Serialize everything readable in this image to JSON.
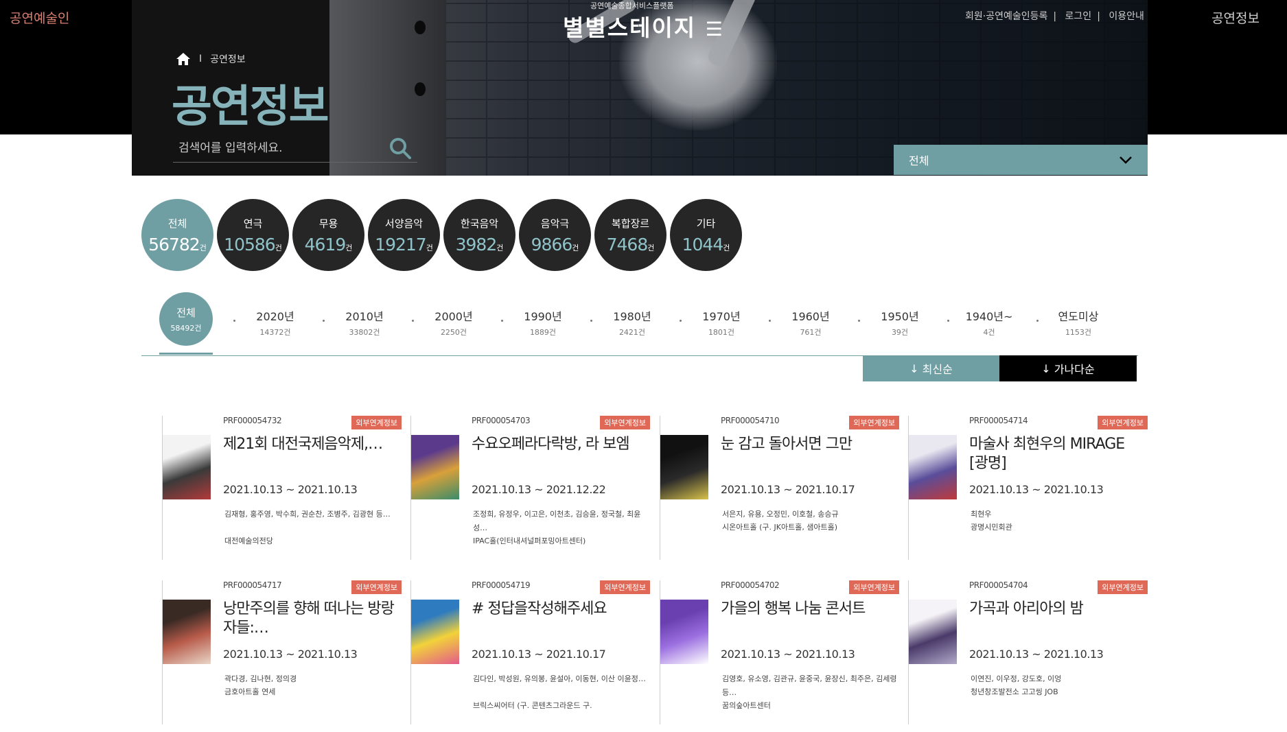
{
  "corner": {
    "left": "공연예술인",
    "right": "공연정보"
  },
  "logo": {
    "sub": "공연예술종합서비스플랫폼",
    "main": "별별스테이지"
  },
  "top_menu": [
    "회원·공연예술인등록",
    "로그인",
    "이용안내"
  ],
  "breadcrumb": {
    "separator": "I",
    "current": "공연정보"
  },
  "page_title": "공연정보",
  "search": {
    "placeholder": "검색어를 입력하세요."
  },
  "filter": {
    "selected": "전체"
  },
  "genres": [
    {
      "name": "전체",
      "count": "56782",
      "unit": "건",
      "active": true
    },
    {
      "name": "연극",
      "count": "10586",
      "unit": "건"
    },
    {
      "name": "무용",
      "count": "4619",
      "unit": "건"
    },
    {
      "name": "서양음악",
      "count": "19217",
      "unit": "건"
    },
    {
      "name": "한국음악",
      "count": "3982",
      "unit": "건"
    },
    {
      "name": "음악극",
      "count": "9866",
      "unit": "건"
    },
    {
      "name": "복합장르",
      "count": "7468",
      "unit": "건"
    },
    {
      "name": "기타",
      "count": "1044",
      "unit": "건"
    }
  ],
  "years": [
    {
      "label": "전체",
      "count": "58492건",
      "active": true
    },
    {
      "label": "2020년",
      "count": "14372건"
    },
    {
      "label": "2010년",
      "count": "33802건"
    },
    {
      "label": "2000년",
      "count": "2250건"
    },
    {
      "label": "1990년",
      "count": "1889건"
    },
    {
      "label": "1980년",
      "count": "2421건"
    },
    {
      "label": "1970년",
      "count": "1801건"
    },
    {
      "label": "1960년",
      "count": "761건"
    },
    {
      "label": "1950년",
      "count": "39건"
    },
    {
      "label": "1940년~",
      "count": "4건"
    },
    {
      "label": "연도미상",
      "count": "1153건"
    }
  ],
  "sort": {
    "latest": "최신순",
    "alpha": "가나다순"
  },
  "badge_label": "외부연계정보",
  "cards": [
    {
      "code": "PRF000054732",
      "name": "제21회 대전국제음악제,…",
      "period": "2021.10.13 ~ 2021.10.13",
      "cast": "김재형, 홍주영, 박수희, 권순찬, 조병주, 김광현 등…",
      "venue": "대전예술의전당",
      "thumb_colors": [
        "#f3f3f3",
        "#3a3a3a",
        "#b33a3a"
      ]
    },
    {
      "code": "PRF000054703",
      "name": "수요오페라다락방, 라 보엠",
      "period": "2021.10.13 ~ 2021.12.22",
      "cast": "조정희, 유정우, 이고은, 이천초, 김승윤, 정국철, 최윤성…",
      "venue": "IPAC홀(인터내셔널퍼포밍아트센터)",
      "thumb_colors": [
        "#5b3a8c",
        "#d9a03a",
        "#3a8c6a"
      ]
    },
    {
      "code": "PRF000054710",
      "name": "눈 감고 돌아서면 그만",
      "period": "2021.10.13 ~ 2021.10.17",
      "cast": "서은지, 유용, 오정민, 이호철, 송승규",
      "venue": "시온아트홀 (구. JK아트홀, 샘아트홀)",
      "thumb_colors": [
        "#111111",
        "#2a2a2a",
        "#d8c24a"
      ]
    },
    {
      "code": "PRF000054714",
      "name": "마술사 최현우의 MIRAGE [광명]",
      "period": "2021.10.13 ~ 2021.10.13",
      "cast": "최현우",
      "venue": "광명시민회관",
      "thumb_colors": [
        "#e9e7f0",
        "#5a4d9a",
        "#c03a3a"
      ]
    },
    {
      "code": "PRF000054717",
      "name": "낭만주의를 향해 떠나는 방랑자들:…",
      "period": "2021.10.13 ~ 2021.10.13",
      "cast": "곽다경, 김나현, 정의경",
      "venue": "금호아트홀 연세",
      "thumb_colors": [
        "#3a2a24",
        "#b85b4a",
        "#e8d6c8"
      ]
    },
    {
      "code": "PRF000054719",
      "name": "# 정답을작성해주세요",
      "period": "2021.10.13 ~ 2021.10.17",
      "cast": "김다인, 박성원, 유의봉, 윤설아, 이동현, 이산 이윤정…",
      "venue": "브릭스씨어터 (구. 콘텐츠그라운드 구.",
      "thumb_colors": [
        "#2f7bbf",
        "#f2d23a",
        "#e35b8a"
      ]
    },
    {
      "code": "PRF000054702",
      "name": "가을의 행복 나눔 콘서트",
      "period": "2021.10.13 ~ 2021.10.13",
      "cast": "김영호, 유소영, 김관규, 윤중국, 윤장신, 최주은, 김세령 등…",
      "venue": "꿈의숲아트센터",
      "thumb_colors": [
        "#6a3fb0",
        "#9b6fe0",
        "#ffffff"
      ]
    },
    {
      "code": "PRF000054704",
      "name": "가곡과 아리아의 밤",
      "period": "2021.10.13 ~ 2021.10.13",
      "cast": "이연진, 이우정, 강도호, 이엉",
      "venue": "청년창조발전소 고고씽 JOB",
      "thumb_colors": [
        "#f5f3f7",
        "#4a3a6a",
        "#b0a8c8"
      ]
    }
  ]
}
